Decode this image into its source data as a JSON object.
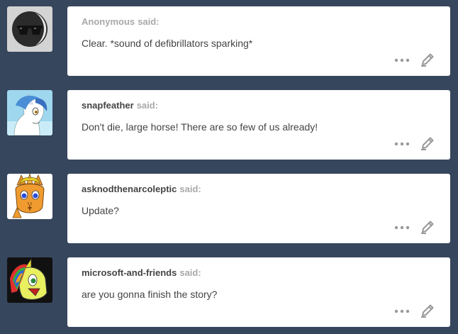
{
  "asks": [
    {
      "asker": "Anonymous",
      "said": "said:",
      "question": "Clear. *sound of defibrillators sparking*",
      "avatar_icon": "anonymous-sunglasses-avatar",
      "more_icon": "ellipsis-icon",
      "edit_icon": "pencil-icon"
    },
    {
      "asker": "snapfeather",
      "said": "said:",
      "question": "Don't die, large horse! There are so few of us already!",
      "avatar_icon": "white-unicorn-avatar",
      "more_icon": "ellipsis-icon",
      "edit_icon": "pencil-icon"
    },
    {
      "asker": "asknodthenarcoleptic",
      "said": "said:",
      "question": "Update?",
      "avatar_icon": "orange-unicorn-avatar",
      "more_icon": "ellipsis-icon",
      "edit_icon": "pencil-icon"
    },
    {
      "asker": "microsoft-and-friends",
      "said": "said:",
      "question": "are you gonna finish the story?",
      "avatar_icon": "rainbow-pony-avatar",
      "more_icon": "ellipsis-icon",
      "edit_icon": "pencil-icon"
    }
  ],
  "colors": {
    "background": "#36465d",
    "card": "#ffffff",
    "asker_name": "#444444",
    "muted": "#a8a8a8",
    "question_text": "#444444",
    "icons": "#999999"
  }
}
